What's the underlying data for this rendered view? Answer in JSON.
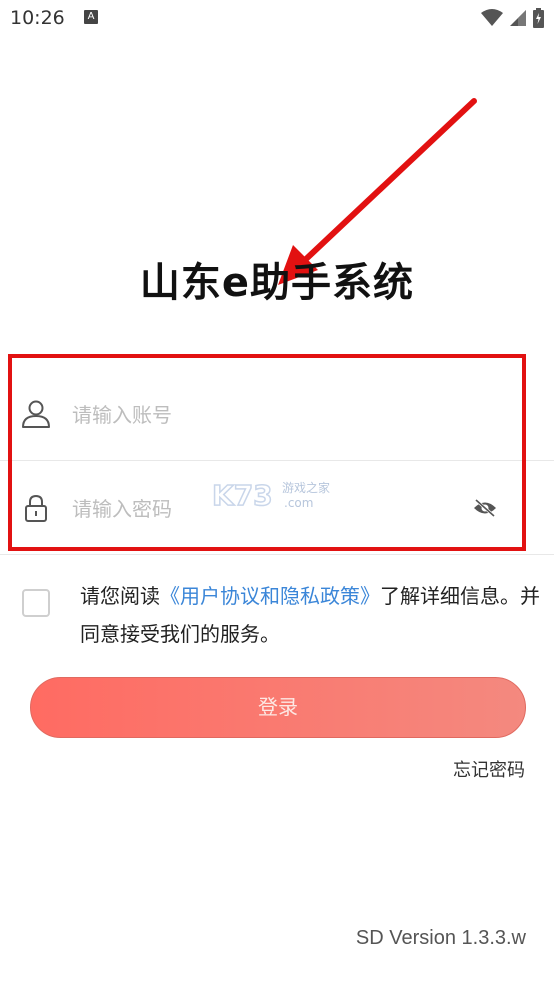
{
  "status_bar": {
    "time": "10:26",
    "notification_icon": "A"
  },
  "app": {
    "title": "山东e助手系统",
    "version": "SD Version 1.3.3.w"
  },
  "login_form": {
    "account_placeholder": "请输入账号",
    "password_placeholder": "请输入密码",
    "agreement_prefix": "请您阅读",
    "agreement_link": "《用户协议和隐私政策》",
    "agreement_suffix": "了解详细信息。并同意接受我们的服务。",
    "agreement_checked": false,
    "login_label": "登录",
    "forgot_label": "忘记密码"
  },
  "watermark": {
    "main": "K73",
    "sub_top": "游戏之家",
    "sub_bottom": ".com"
  },
  "colors": {
    "annotation": "#e21111",
    "link": "#3b86d8",
    "button_start": "#ff6b62",
    "button_end": "#f4897f"
  }
}
